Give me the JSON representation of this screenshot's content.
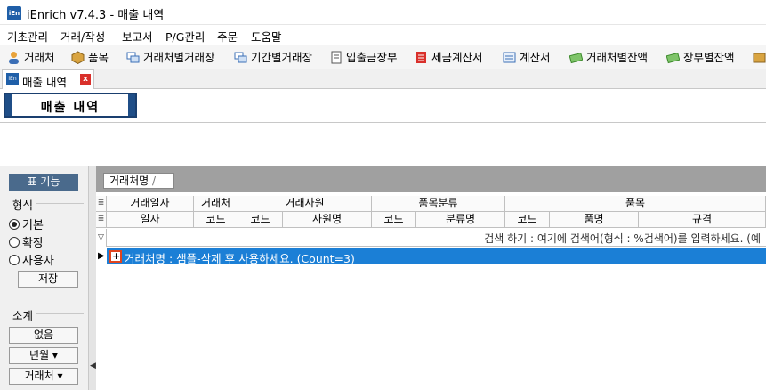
{
  "window": {
    "title": "iEnrich v7.4.3 - 매출 내역",
    "icon": "app-logo-icon"
  },
  "menu": [
    "기초관리",
    "거래/작성",
    "보고서",
    "P/G관리",
    "주문",
    "도움말"
  ],
  "toolbar": [
    {
      "label": "거래처",
      "icon": "person-icon"
    },
    {
      "label": "품목",
      "icon": "box-icon"
    },
    {
      "label": "거래처별거래장",
      "icon": "ledger-icon"
    },
    {
      "label": "기간별거래장",
      "icon": "ledger-icon"
    },
    {
      "label": "입출금장부",
      "icon": "book-icon"
    },
    {
      "label": "세금계산서",
      "icon": "invoice-icon"
    },
    {
      "label": "계산서",
      "icon": "document-icon"
    },
    {
      "label": "거래처별잔액",
      "icon": "money-icon"
    },
    {
      "label": "장부별잔액",
      "icon": "money-icon"
    }
  ],
  "tab": {
    "label": "매출 내역",
    "close": "x"
  },
  "form_title": "매출 내역",
  "left_panel": {
    "header": "표 기능",
    "format_label": "형식",
    "radios": [
      {
        "label": "기본",
        "checked": true
      },
      {
        "label": "확장",
        "checked": false
      },
      {
        "label": "사용자",
        "checked": false
      }
    ],
    "save": "저장",
    "subtotal_label": "소계",
    "buttons": [
      "없음",
      "년월 ▾",
      "거래처 ▾"
    ]
  },
  "group_chip": "거래처명",
  "grid": {
    "header_top": [
      "거래일자",
      "거래처",
      "거래사원",
      "품목분류",
      "품목"
    ],
    "header_bottom": [
      "일자",
      "코드",
      "코드",
      "사원명",
      "코드",
      "분류명",
      "코드",
      "품명",
      "규격"
    ],
    "search_hint": "검색 하기 : 여기에 검색어(형식 : %검색어)를 입력하세요. (예",
    "group_row": "거래처명 : 샘플-삭제 후 사용하세요. (Count=3)"
  }
}
